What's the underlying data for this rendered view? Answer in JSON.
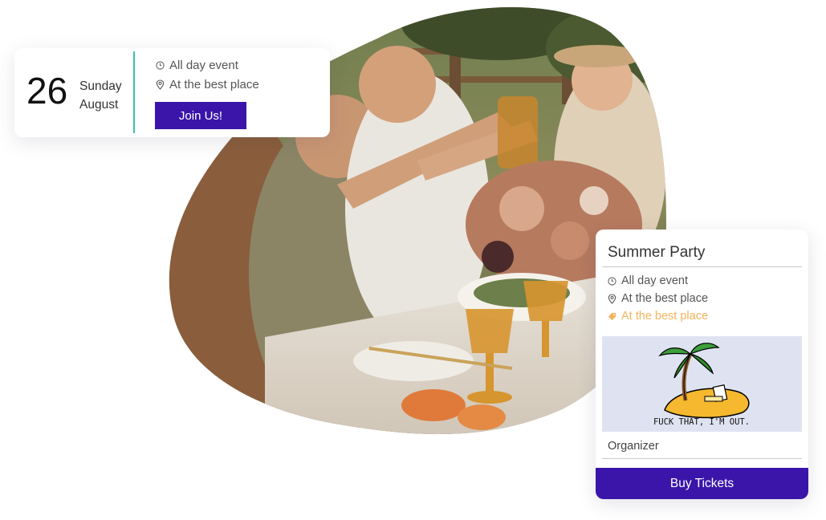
{
  "date_card": {
    "day_number": "26",
    "weekday": "Sunday",
    "month": "August",
    "time_text": "All day event",
    "place_text": "At the best place",
    "join_label": "Join Us!"
  },
  "event_card": {
    "title": "Summer Party",
    "time_text": "All day event",
    "place_text": "At the best place",
    "tag_text": "At the best place",
    "image_caption": "FUCK THAT, I'M OUT.",
    "organizer_label": "Organizer",
    "buy_label": "Buy Tickets"
  },
  "colors": {
    "accent": "#3b15a9",
    "divider": "#3fc0a6",
    "tag": "#f2b45b",
    "image_bg": "#dfe3f1"
  },
  "icons": {
    "time": "clock-icon",
    "place": "location-pin-icon",
    "tag": "tag-icon"
  }
}
